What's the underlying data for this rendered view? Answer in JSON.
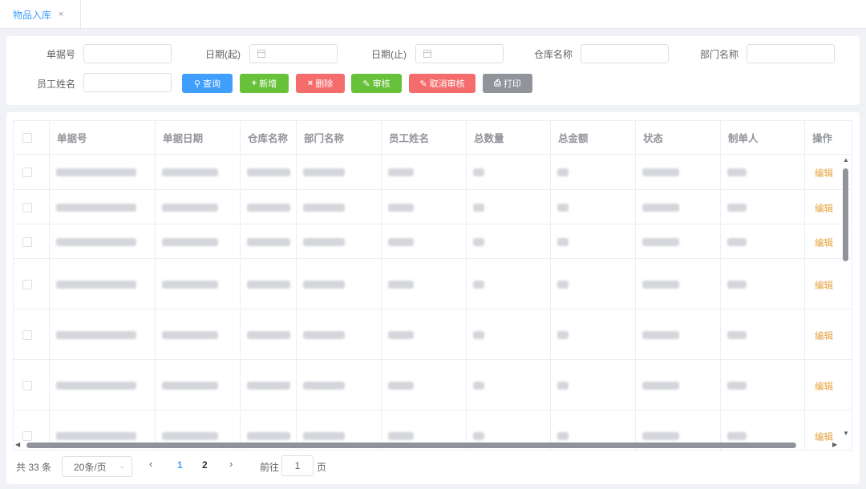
{
  "tab": {
    "label": "物品入库",
    "close": "×"
  },
  "filters": {
    "order_no": "单据号",
    "date_start": "日期(起)",
    "date_end": "日期(止)",
    "warehouse": "仓库名称",
    "department": "部门名称",
    "employee": "员工姓名"
  },
  "buttons": {
    "query": "查询",
    "add": "新增",
    "delete": "删除",
    "approve": "审核",
    "cancel_approve": "取消审核",
    "print": "打印"
  },
  "table": {
    "columns": [
      "单据号",
      "单据日期",
      "仓库名称",
      "部门名称",
      "员工姓名",
      "总数量",
      "总金额",
      "状态",
      "制单人",
      "操作"
    ],
    "row_action": "编辑"
  },
  "pagination": {
    "total": "共 33 条",
    "page_size": "20条/页",
    "pages": [
      "1",
      "2"
    ],
    "current_page": "1",
    "goto_prefix": "前往",
    "goto_value": "1",
    "goto_suffix": "页"
  },
  "colors": {
    "primary": "#409eff",
    "success": "#67c23a",
    "danger": "#f56c6c",
    "info": "#909399",
    "warning": "#e6a23c"
  }
}
